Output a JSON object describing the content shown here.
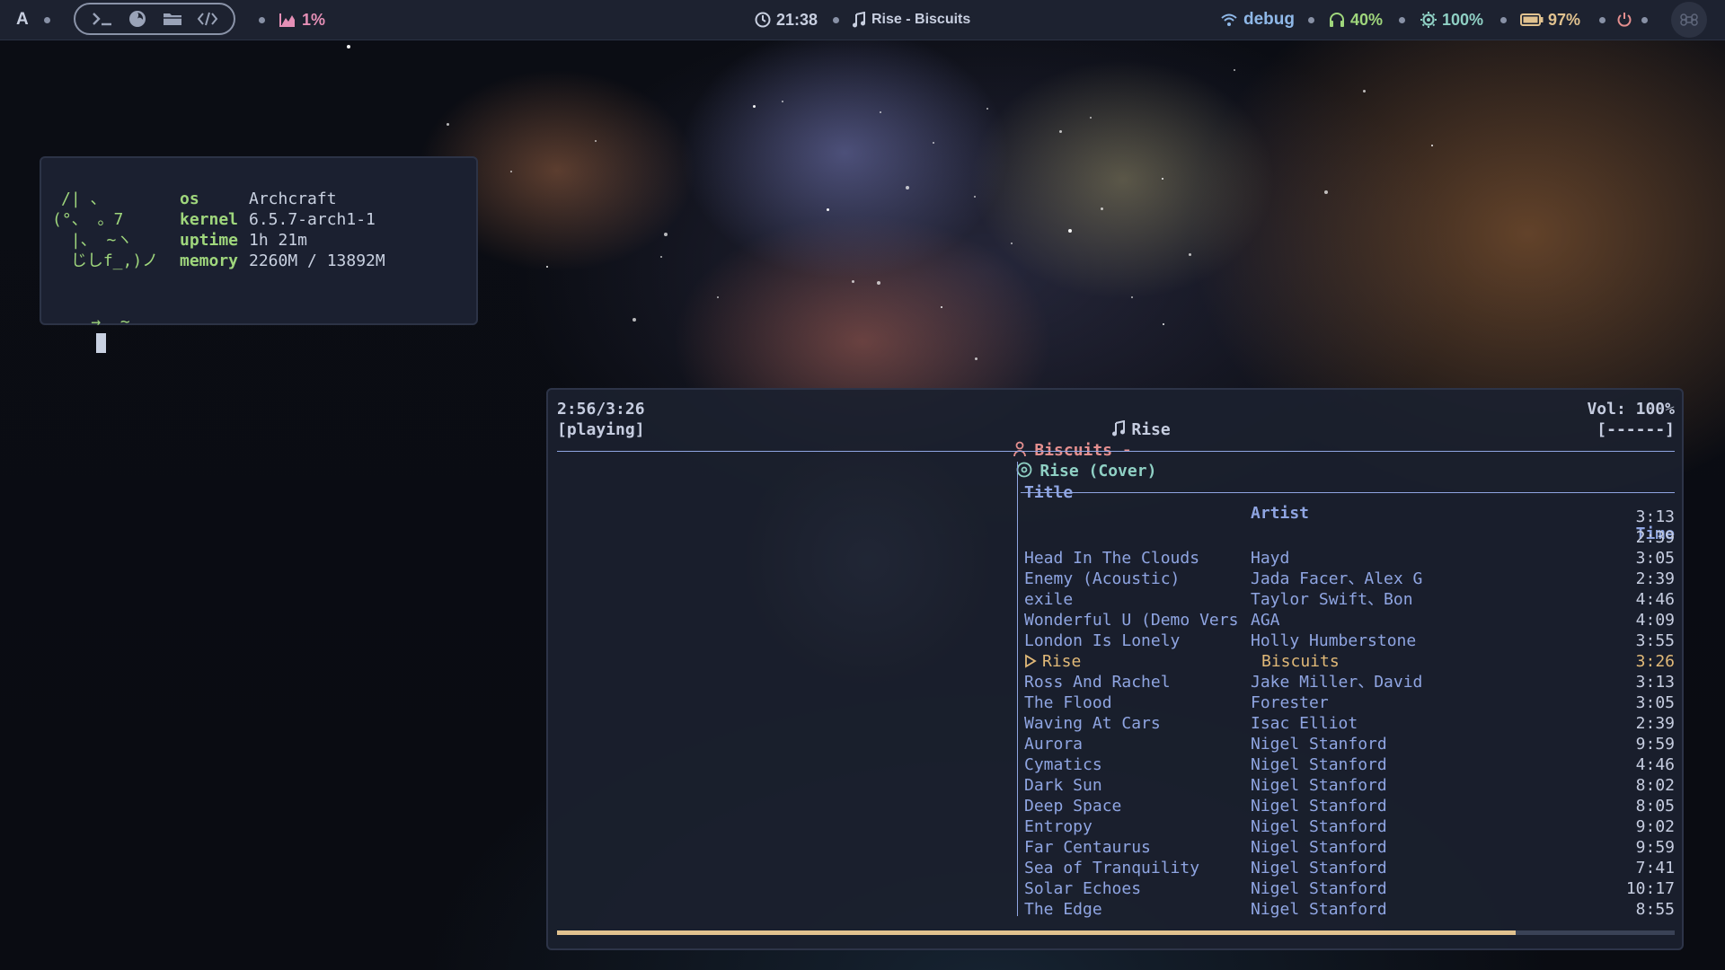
{
  "topbar": {
    "launcher_letter": "A",
    "launcher_icons": [
      "terminal-icon",
      "firefox-icon",
      "folder-icon",
      "code-icon"
    ],
    "cpu": "1%",
    "clock": "21:38",
    "now_playing": "Rise - Biscuits",
    "network": "debug",
    "volume": "40%",
    "brightness": "100%",
    "battery": "97%"
  },
  "terminal": {
    "ascii": [
      "/| 、",
      "(°、 。7",
      " |、 ~ヽ",
      " じしf_,)ノ"
    ],
    "info": [
      {
        "key": "os",
        "value": "Archcraft"
      },
      {
        "key": "kernel",
        "value": "6.5.7-arch1-1"
      },
      {
        "key": "uptime",
        "value": "1h 21m"
      },
      {
        "key": "memory",
        "value": "2260M / 13892M"
      }
    ],
    "prompt": "→  ~"
  },
  "player": {
    "elapsed": "2:56/3:26",
    "state": "[playing]",
    "song": "Rise",
    "artist": "Biscuits",
    "separator": "-",
    "album": "Rise (Cover)",
    "volume_label": "Vol: 100%",
    "volume_bar": "[------]",
    "progress": 0.858,
    "columns": {
      "title": "Title",
      "artist": "Artist",
      "time": "Time"
    },
    "rows": [
      {
        "title": "",
        "artist": "",
        "time": "3:13"
      },
      {
        "title": "",
        "artist": "",
        "time": "2:39"
      },
      {
        "title": "Head In The Clouds",
        "artist": "Hayd",
        "time": "3:05"
      },
      {
        "title": "Enemy (Acoustic)",
        "artist": "Jada Facer、Alex G",
        "time": "2:39"
      },
      {
        "title": "exile",
        "artist": "Taylor Swift、Bon",
        "time": "4:46"
      },
      {
        "title": "Wonderful U (Demo Vers",
        "artist": "AGA",
        "time": "4:09"
      },
      {
        "title": "London Is Lonely",
        "artist": "Holly Humberstone",
        "time": "3:55"
      },
      {
        "title": "Rise",
        "artist": "Biscuits",
        "time": "3:26",
        "current": true
      },
      {
        "title": "Ross And Rachel",
        "artist": "Jake Miller、David",
        "time": "3:13"
      },
      {
        "title": "The Flood",
        "artist": "Forester",
        "time": "3:05"
      },
      {
        "title": "Waving At Cars",
        "artist": "Isac Elliot",
        "time": "2:39"
      },
      {
        "title": "Aurora",
        "artist": "Nigel Stanford",
        "time": "9:59"
      },
      {
        "title": "Cymatics",
        "artist": "Nigel Stanford",
        "time": "4:46"
      },
      {
        "title": "Dark Sun",
        "artist": "Nigel Stanford",
        "time": "8:02"
      },
      {
        "title": "Deep Space",
        "artist": "Nigel Stanford",
        "time": "8:05"
      },
      {
        "title": "Entropy",
        "artist": "Nigel Stanford",
        "time": "9:02"
      },
      {
        "title": "Far Centaurus",
        "artist": "Nigel Stanford",
        "time": "9:59"
      },
      {
        "title": "Sea of Tranquility",
        "artist": "Nigel Stanford",
        "time": "7:41"
      },
      {
        "title": "Solar Echoes",
        "artist": "Nigel Stanford",
        "time": "10:17"
      },
      {
        "title": "The Edge",
        "artist": "Nigel Stanford",
        "time": "8:55"
      }
    ]
  },
  "colors": {
    "bar_bg": "#1d2230",
    "accent_green": "#9fd67c",
    "accent_blue": "#8fa5e2",
    "accent_red": "#e58f8f",
    "accent_teal": "#8fd0c4",
    "accent_gold": "#e1b978"
  }
}
